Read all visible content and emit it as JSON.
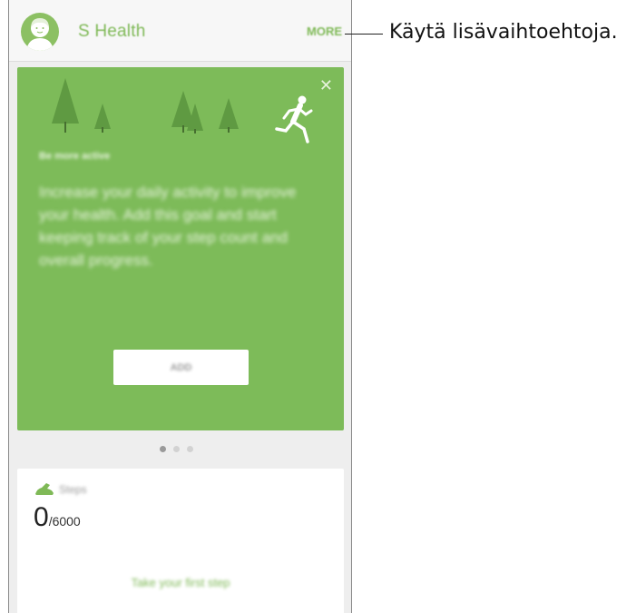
{
  "app": {
    "title": "S Health",
    "more_label": "MORE"
  },
  "goal_card": {
    "title": "Be more active",
    "description": "Increase your daily activity to improve your health. Add this goal and start keeping track of your step count and overall progress.",
    "add_label": "ADD",
    "close_icon": "close-icon",
    "illustration_icon": "runner-icon"
  },
  "pager": {
    "pages": 3,
    "active_index": 0
  },
  "steps_card": {
    "label": "Steps",
    "current": "0",
    "goal": "/6000",
    "hint": "Take your first step",
    "icon": "shoe-icon"
  },
  "callout": {
    "text": "Käytä lisävaihtoehtoja."
  },
  "colors": {
    "brand_green": "#7dbb59",
    "accent_text_green": "#7fb957"
  }
}
